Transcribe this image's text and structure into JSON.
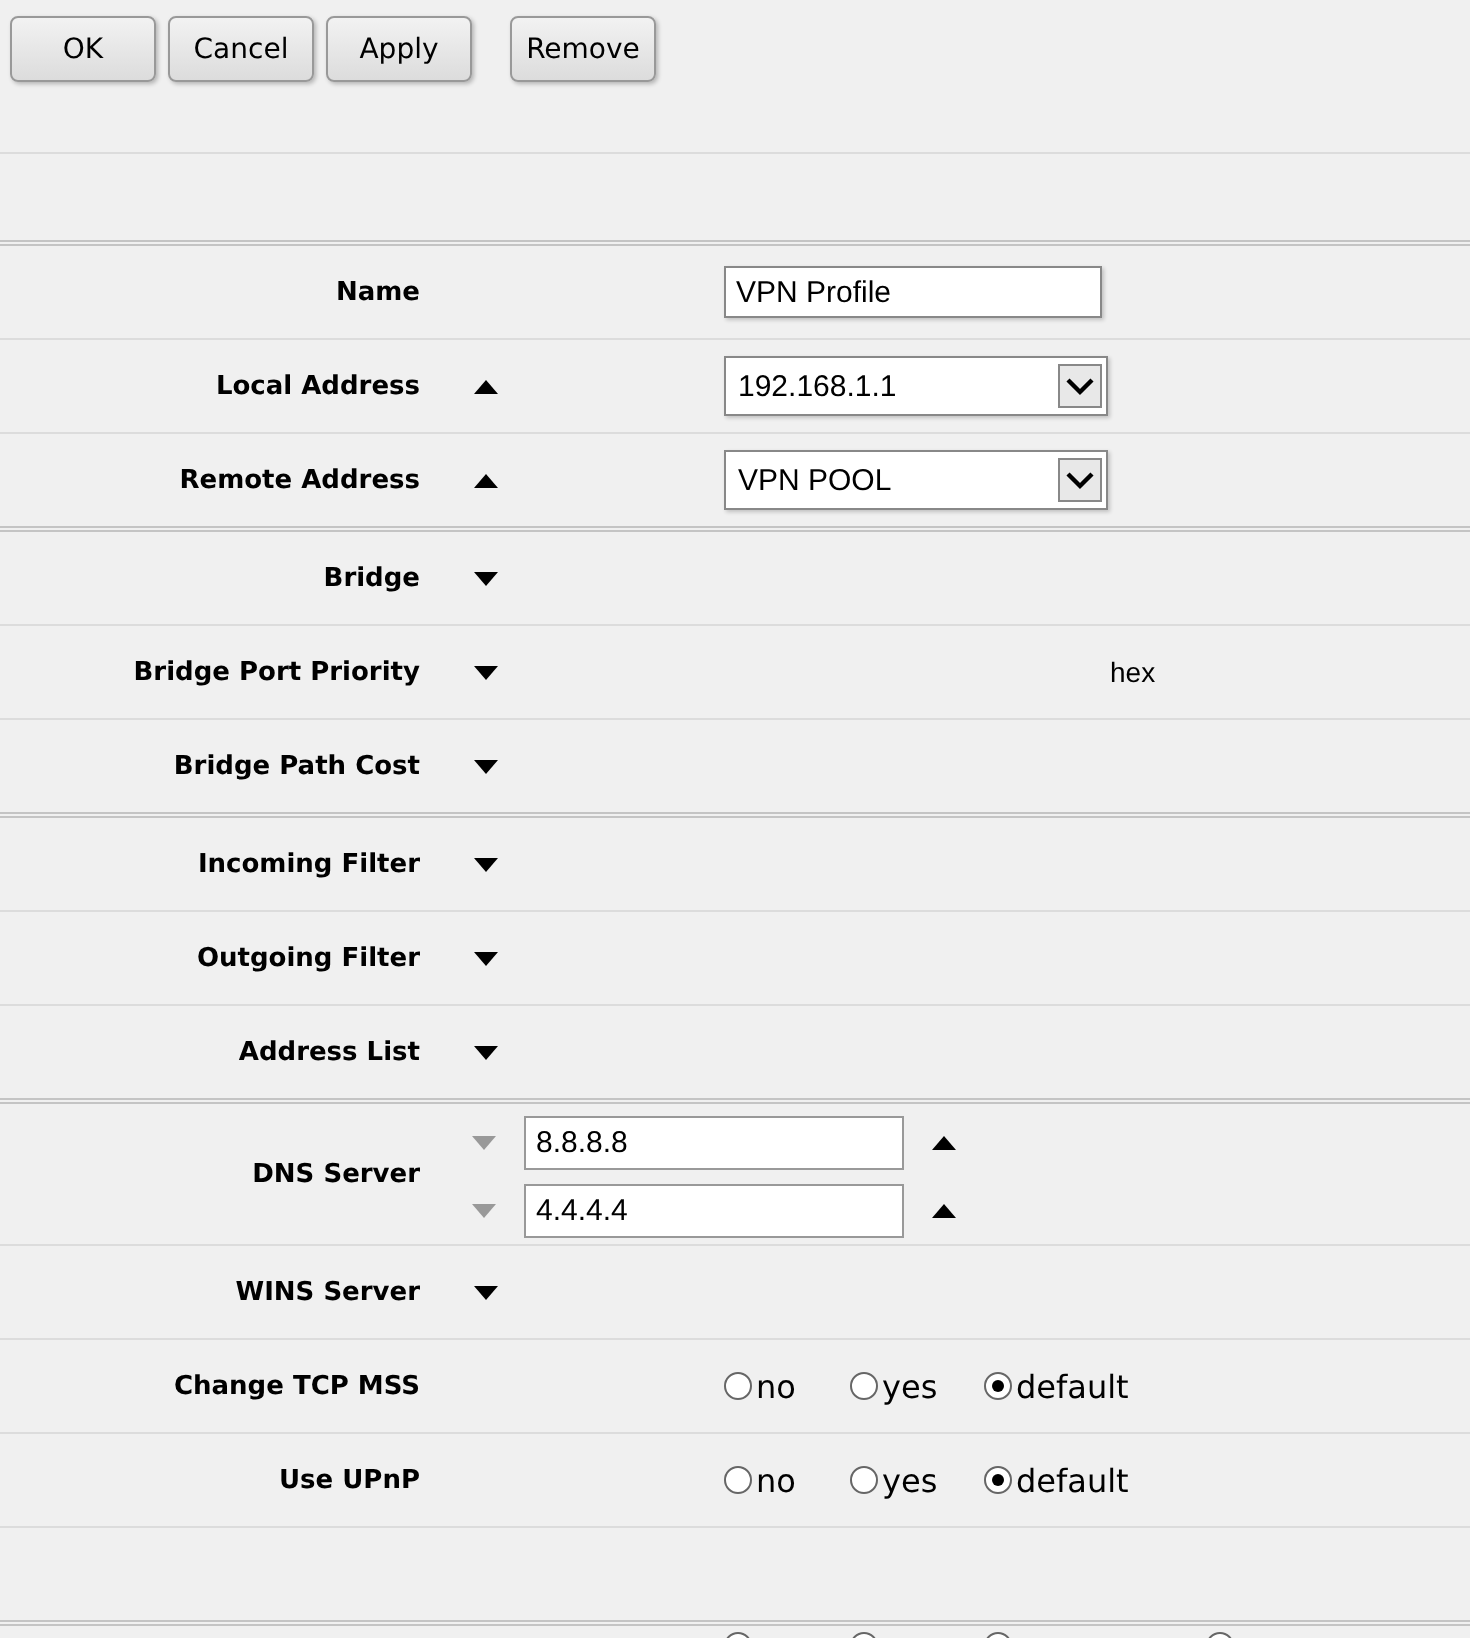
{
  "toolbar": {
    "buttons": [
      {
        "label": "OK"
      },
      {
        "label": "Cancel"
      },
      {
        "label": "Apply"
      },
      {
        "label": "Remove"
      }
    ]
  },
  "groups": [
    {
      "rows": [
        {
          "label": "Name",
          "kind": "text",
          "value": "VPN Profile"
        },
        {
          "label": "Local Address",
          "expanded": true,
          "kind": "select",
          "value": "192.168.1.1"
        },
        {
          "label": "Remote Address",
          "expanded": true,
          "kind": "select",
          "value": "VPN POOL"
        }
      ]
    },
    {
      "rows": [
        {
          "label": "Bridge",
          "expanded": false,
          "kind": "empty"
        },
        {
          "label": "Bridge Port Priority",
          "expanded": false,
          "kind": "unit",
          "unit": "hex"
        },
        {
          "label": "Bridge Path Cost",
          "expanded": false,
          "kind": "empty"
        }
      ]
    },
    {
      "rows": [
        {
          "label": "Incoming Filter",
          "expanded": false,
          "kind": "empty"
        },
        {
          "label": "Outgoing Filter",
          "expanded": false,
          "kind": "empty"
        },
        {
          "label": "Address List",
          "expanded": false,
          "kind": "empty"
        }
      ]
    },
    {
      "rows": [
        {
          "label": "DNS Server",
          "kind": "list",
          "values": [
            "8.8.8.8",
            "4.4.4.4"
          ]
        },
        {
          "label": "WINS Server",
          "expanded": false,
          "kind": "empty"
        },
        {
          "label": "Change TCP MSS",
          "kind": "radio",
          "options": [
            {
              "label": "no",
              "selected": false
            },
            {
              "label": "yes",
              "selected": false
            },
            {
              "label": "default",
              "selected": true
            }
          ]
        },
        {
          "label": "Use UPnP",
          "kind": "radio",
          "options": [
            {
              "label": "no",
              "selected": false
            },
            {
              "label": "yes",
              "selected": false
            },
            {
              "label": "default",
              "selected": true
            }
          ]
        },
        {
          "kind": "empty"
        }
      ]
    },
    {
      "rows": [
        {
          "kind": "radio",
          "options": [
            {
              "kind": "radio"
            },
            {
              "kind": "radio"
            },
            {
              "kind": "radio"
            },
            {
              "kind": "radio"
            }
          ]
        }
      ]
    }
  ]
}
